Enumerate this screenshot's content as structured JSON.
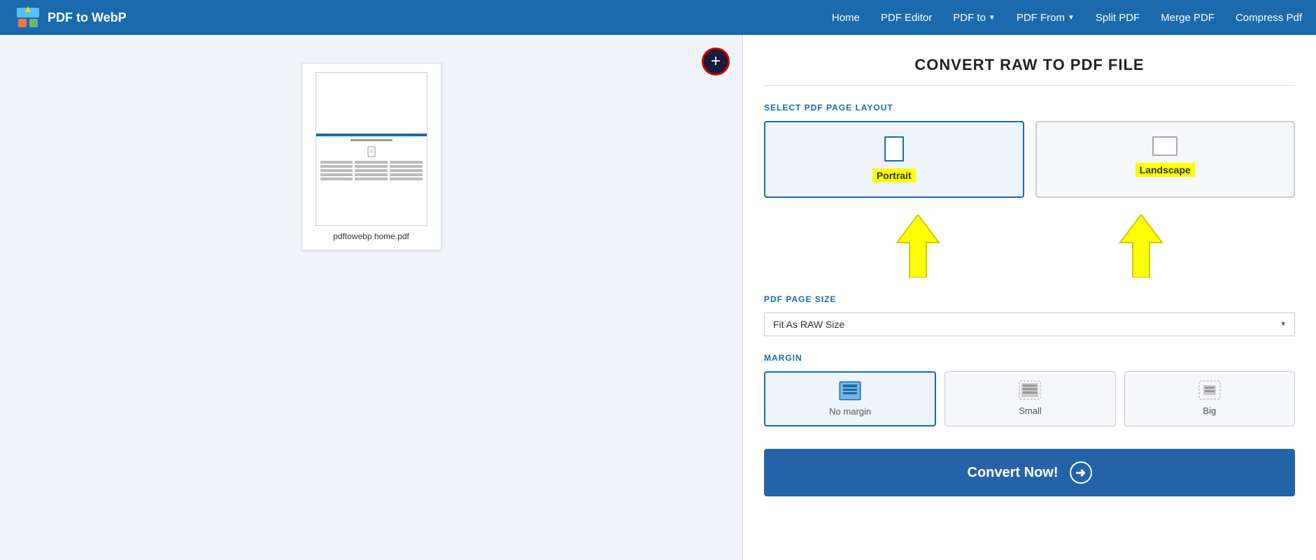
{
  "header": {
    "logo_text": "PDF to WebP",
    "nav": [
      {
        "label": "Home",
        "has_dropdown": false
      },
      {
        "label": "PDF Editor",
        "has_dropdown": false
      },
      {
        "label": "PDF to",
        "has_dropdown": true
      },
      {
        "label": "PDF From",
        "has_dropdown": true
      },
      {
        "label": "Split PDF",
        "has_dropdown": false
      },
      {
        "label": "Merge PDF",
        "has_dropdown": false
      },
      {
        "label": "Compress Pdf",
        "has_dropdown": false
      }
    ]
  },
  "left_panel": {
    "add_button_label": "+",
    "file_name": "pdftowebp home.pdf"
  },
  "right_panel": {
    "title": "CONVERT RAW TO PDF FILE",
    "layout_section_label": "SELECT PDF PAGE LAYOUT",
    "layout_options": [
      {
        "id": "portrait",
        "label": "Portrait",
        "active": true
      },
      {
        "id": "landscape",
        "label": "Landscape",
        "active": false
      }
    ],
    "page_size_section_label": "PDF PAGE SIZE",
    "page_size_value": "Fit As RAW Size",
    "margin_section_label": "MARGIN",
    "margin_options": [
      {
        "id": "no-margin",
        "label": "No margin",
        "active": true
      },
      {
        "id": "small",
        "label": "Small",
        "active": false
      },
      {
        "id": "big",
        "label": "Big",
        "active": false
      }
    ],
    "convert_button_label": "Convert Now!"
  }
}
